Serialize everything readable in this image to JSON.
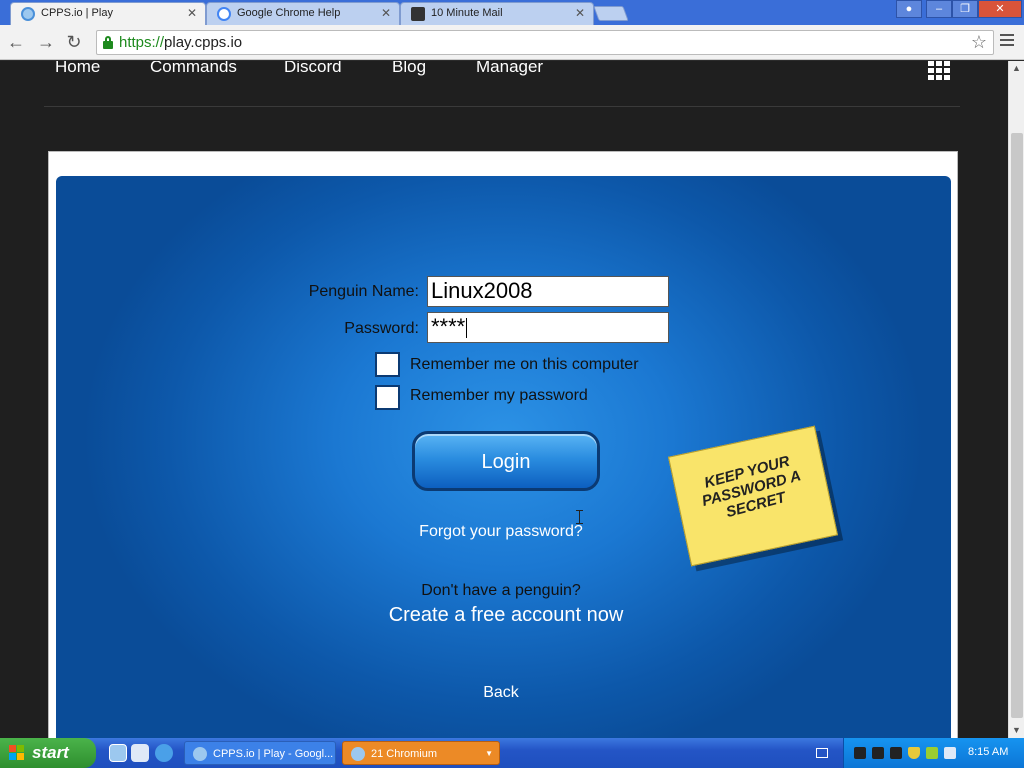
{
  "browser": {
    "tabs": [
      {
        "title": "CPPS.io | Play",
        "active": true
      },
      {
        "title": "Google Chrome Help",
        "active": false
      },
      {
        "title": "10 Minute Mail",
        "active": false
      }
    ],
    "url_scheme": "https://",
    "url_host": "play.cpps.io"
  },
  "site_nav": {
    "links": [
      "Home",
      "Commands",
      "Discord",
      "Blog",
      "Manager"
    ]
  },
  "login": {
    "name_label": "Penguin Name:",
    "name_value": "Linux2008",
    "password_label": "Password:",
    "password_value": "****",
    "remember_me_label": "Remember me on this computer",
    "remember_password_label": "Remember my password",
    "login_button": "Login",
    "forgot_link": "Forgot your password?",
    "no_penguin_text": "Don't have a penguin?",
    "create_account_link": "Create a free account now",
    "back_link": "Back",
    "sticky_note": "KEEP YOUR PASSWORD A SECRET"
  },
  "taskbar": {
    "start_label": "start",
    "items": [
      {
        "label": "CPPS.io | Play - Googl..."
      },
      {
        "label": "21 Chromium"
      }
    ],
    "clock": "8:15 AM"
  }
}
